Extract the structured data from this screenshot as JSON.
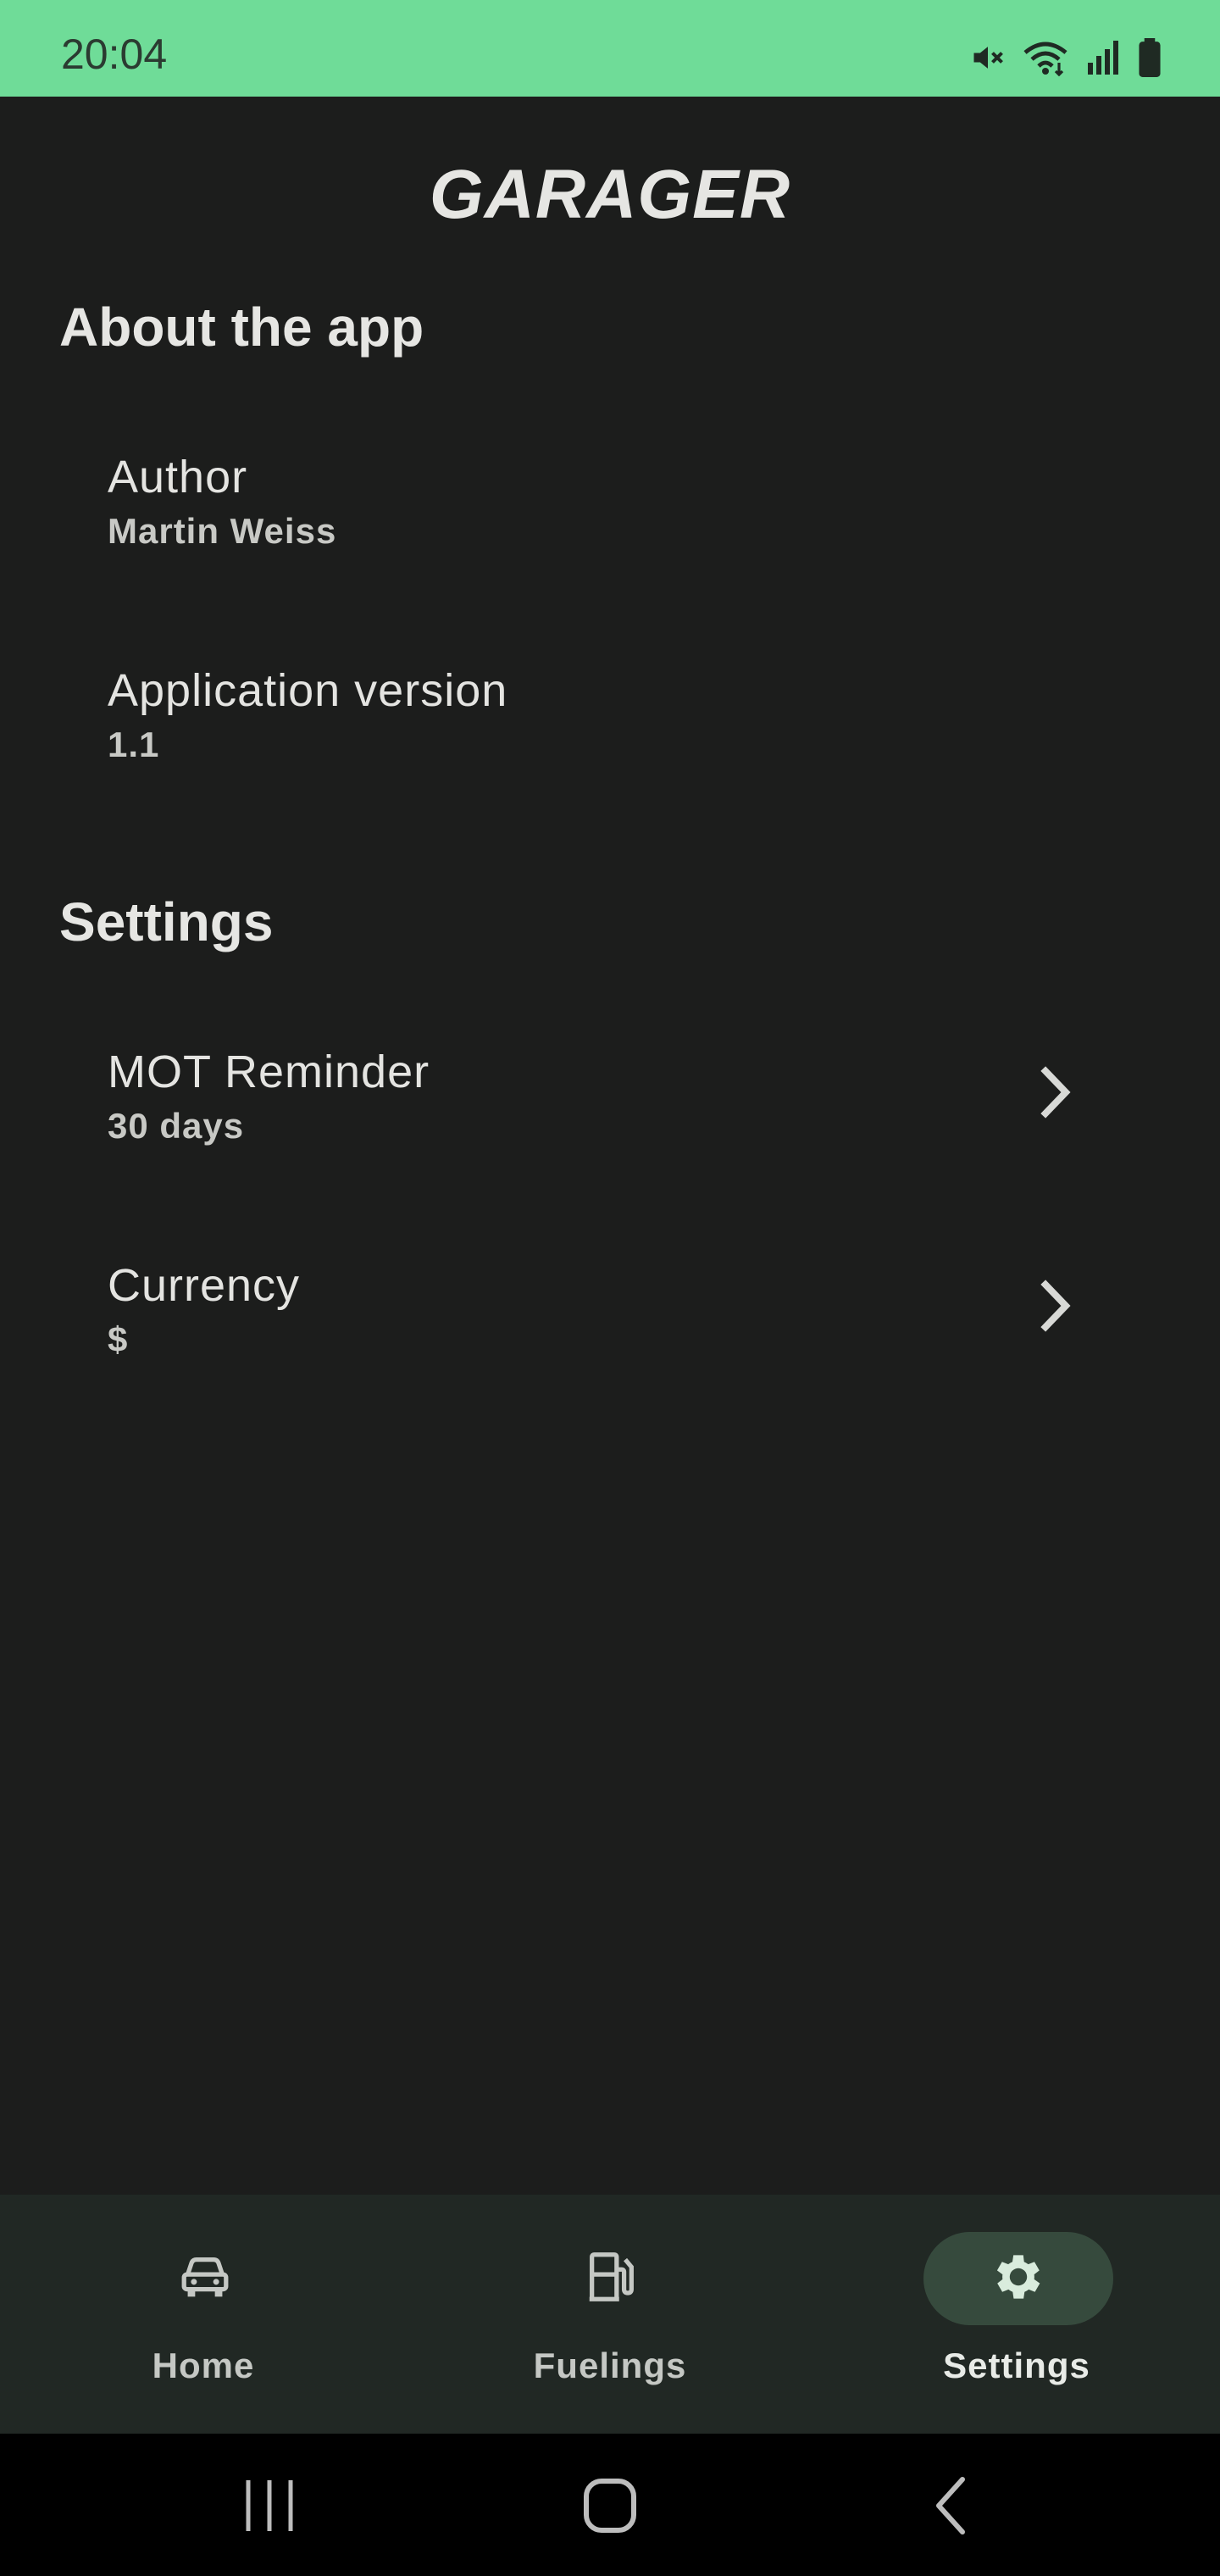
{
  "status_bar": {
    "time": "20:04",
    "icons": [
      "mute-icon",
      "wifi-icon",
      "signal-icon",
      "battery-icon"
    ],
    "background": "#6fdc98"
  },
  "app": {
    "title": "GARAGER"
  },
  "about": {
    "heading": "About the app",
    "items": [
      {
        "title": "Author",
        "summary": "Martin Weiss"
      },
      {
        "title": "Application version",
        "summary": "1.1"
      }
    ]
  },
  "settings": {
    "heading": "Settings",
    "items": [
      {
        "title": "MOT Reminder",
        "summary": "30 days",
        "icon": "chevron-right-icon"
      },
      {
        "title": "Currency",
        "summary": "$",
        "icon": "chevron-right-icon"
      }
    ]
  },
  "bottom_nav": {
    "items": [
      {
        "label": "Home",
        "icon": "car-icon",
        "active": false
      },
      {
        "label": "Fuelings",
        "icon": "fuel-pump-icon",
        "active": false
      },
      {
        "label": "Settings",
        "icon": "gear-icon",
        "active": true
      }
    ],
    "active_pill_color": "#364a3d"
  },
  "system_nav": {
    "buttons": [
      "recent-apps-icon",
      "home-icon",
      "back-icon"
    ]
  }
}
